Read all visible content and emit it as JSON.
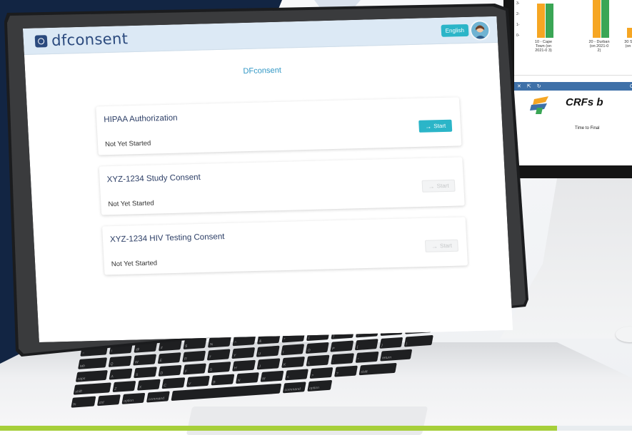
{
  "app": {
    "brand": "dfconsent",
    "language_button": "English",
    "page_title": "DFconsent"
  },
  "cards": [
    {
      "title": "HIPAA Authorization",
      "status": "Not Yet Started",
      "button": "Start",
      "enabled": true
    },
    {
      "title": "XYZ-1234 Study Consent",
      "status": "Not Yet Started",
      "button": "Start",
      "enabled": false
    },
    {
      "title": "XYZ-1234 HIV Testing Consent",
      "status": "Not Yet Started",
      "button": "Start",
      "enabled": false
    }
  ],
  "colors": {
    "accent": "#2bb5c8",
    "brand": "#2b4a7e",
    "header_bg": "#dce9f5",
    "navy": "#122543",
    "green_bar": "#a6cf3a"
  },
  "monitor": {
    "chart": {
      "y_ticks": [
        "3-",
        "2-",
        "1-",
        "0-"
      ],
      "x_labels": [
        "10 - Cape Town (on 2021-0 3)",
        "20 - Durban (on 2021-0 2)",
        "30 Sowe (on 2( 2"
      ]
    },
    "window2_title": "C",
    "crf_title": "CRFs b",
    "crf_subtitle": "Time to Final"
  },
  "keyboard": {
    "rows": [
      [
        "esc",
        "",
        "",
        "",
        "",
        "",
        "",
        "",
        "",
        "",
        "",
        "",
        "",
        ""
      ],
      [
        "~",
        "!",
        "@",
        "#",
        "$",
        "%",
        "^",
        "&",
        "*",
        "(",
        ")",
        "_",
        "+",
        "delete"
      ],
      [
        "tab",
        "Q",
        "W",
        "E",
        "R",
        "T",
        "Y",
        "U",
        "I",
        "O",
        "P",
        "{",
        "}",
        "|"
      ],
      [
        "caps",
        "A",
        "S",
        "D",
        "F",
        "G",
        "H",
        "J",
        "K",
        "L",
        ":",
        "\"",
        "return"
      ],
      [
        "shift",
        "Z",
        "X",
        "C",
        "V",
        "B",
        "N",
        "M",
        "<",
        ">",
        "?",
        "shift"
      ],
      [
        "fn",
        "ctrl",
        "option",
        "command",
        "",
        "command",
        "option"
      ]
    ]
  }
}
